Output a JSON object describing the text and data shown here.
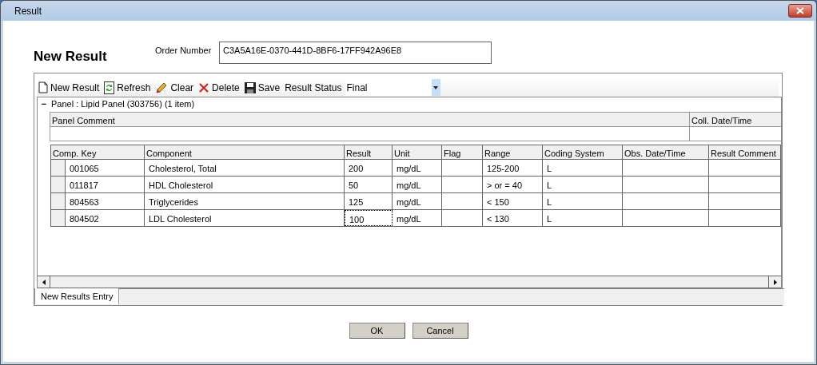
{
  "window": {
    "title": "Result"
  },
  "heading": "New Result",
  "order_number": {
    "label": "Order Number",
    "value": "C3A5A16E-0370-441D-8BF6-17FF942A96E8"
  },
  "toolbar": {
    "buttons": [
      {
        "kind": "new",
        "label": "New Result"
      },
      {
        "kind": "refresh",
        "label": "Refresh"
      },
      {
        "kind": "clear",
        "label": "Clear"
      },
      {
        "kind": "delete",
        "label": "Delete"
      },
      {
        "kind": "save",
        "label": "Save"
      }
    ],
    "status_label": "Result Status",
    "status_value": "Final"
  },
  "panel": {
    "title": "Panel : Lipid Panel (303756) (1 item)",
    "toggle": "−",
    "comment_columns": [
      "Panel Comment",
      "Coll. Date/Time"
    ]
  },
  "table": {
    "columns": [
      "Comp. Key",
      "Component",
      "Result",
      "Unit",
      "Flag",
      "Range",
      "Coding System",
      "Obs. Date/Time",
      "Result Comment"
    ],
    "rows": [
      {
        "cells": [
          "001065",
          "Cholesterol, Total",
          "200",
          "mg/dL",
          "",
          "125-200",
          "L",
          "",
          ""
        ],
        "result_focused": false
      },
      {
        "cells": [
          "011817",
          "HDL Cholesterol",
          "50",
          "mg/dL",
          "",
          "> or = 40",
          "L",
          "",
          ""
        ],
        "result_focused": false
      },
      {
        "cells": [
          "804563",
          "Triglycerides",
          "125",
          "mg/dL",
          "",
          "< 150",
          "L",
          "",
          ""
        ],
        "result_focused": false
      },
      {
        "cells": [
          "804502",
          "LDL Cholesterol",
          "100",
          "mg/dL",
          "",
          "< 130",
          "L",
          "",
          ""
        ],
        "result_focused": true
      }
    ]
  },
  "tabs": [
    {
      "label": "New Results Entry",
      "selected": true
    }
  ],
  "buttons": [
    "OK",
    "Cancel"
  ]
}
